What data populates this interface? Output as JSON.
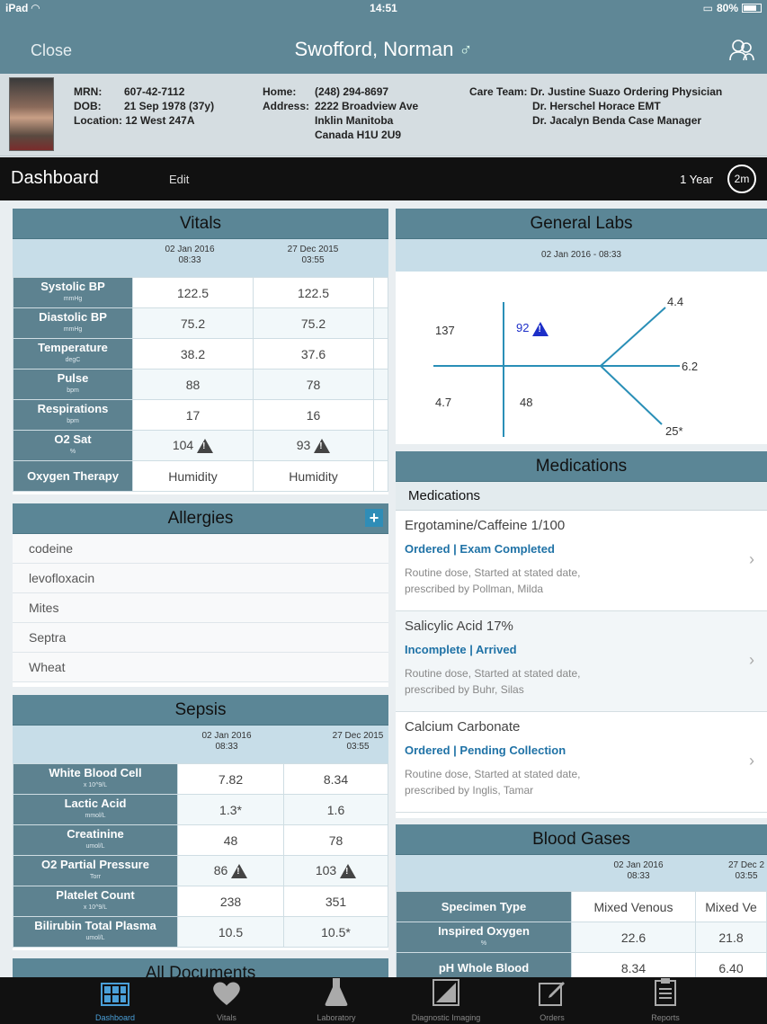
{
  "status_bar": {
    "device": "iPad",
    "time": "14:51",
    "battery": "80%"
  },
  "header": {
    "close_label": "Close",
    "patient_name": "Swofford, Norman",
    "gender_symbol": "♂"
  },
  "banner": {
    "mrn_label": "MRN:",
    "mrn": "607-42-7112",
    "dob_label": "DOB:",
    "dob": "21 Sep 1978 (37y)",
    "location": "Location: 12 West 247A",
    "home_label": "Home:",
    "home": "(248) 294-8697",
    "address_label": "Address:",
    "address1": "2222 Broadview Ave",
    "address2": "Inklin Manitoba",
    "address3": "Canada H1U 2U9",
    "care_team_label": "Care Team:",
    "care_team": [
      "Dr. Justine Suazo Ordering Physician",
      "Dr. Herschel Horace EMT",
      "Dr. Jacalyn Benda Case Manager"
    ]
  },
  "dashboard": {
    "title": "Dashboard",
    "edit": "Edit",
    "range": "1 Year",
    "refresh": "2m"
  },
  "vitals": {
    "title": "Vitals",
    "dates": [
      {
        "date": "02 Jan 2016",
        "time": "08:33"
      },
      {
        "date": "27 Dec 2015",
        "time": "03:55"
      }
    ],
    "rows": [
      {
        "label": "Systolic BP",
        "unit": "mmHg",
        "v1": "122.5",
        "v2": "122.5"
      },
      {
        "label": "Diastolic BP",
        "unit": "mmHg",
        "v1": "75.2",
        "v2": "75.2"
      },
      {
        "label": "Temperature",
        "unit": "degC",
        "v1": "38.2",
        "v2": "37.6"
      },
      {
        "label": "Pulse",
        "unit": "bpm",
        "v1": "88",
        "v2": "78"
      },
      {
        "label": "Respirations",
        "unit": "bpm",
        "v1": "17",
        "v2": "16"
      },
      {
        "label": "O2 Sat",
        "unit": "%",
        "v1": "104",
        "v2": "93"
      },
      {
        "label": "Oxygen Therapy",
        "unit": "",
        "v1": "Humidity",
        "v2": "Humidity"
      }
    ]
  },
  "allergies": {
    "title": "Allergies",
    "items": [
      "codeine",
      "levofloxacin",
      "Mites",
      "Septra",
      "Wheat"
    ]
  },
  "sepsis": {
    "title": "Sepsis",
    "dates": [
      {
        "date": "02 Jan 2016",
        "time": "08:33"
      },
      {
        "date": "27 Dec 2015",
        "time": "03:55"
      }
    ],
    "rows": [
      {
        "label": "White Blood Cell",
        "unit": "x 10^9/L",
        "v1": "7.82",
        "v2": "8.34"
      },
      {
        "label": "Lactic Acid",
        "unit": "mmol/L",
        "v1": "1.3*",
        "v2": "1.6"
      },
      {
        "label": "Creatinine",
        "unit": "umol/L",
        "v1": "48",
        "v2": "78"
      },
      {
        "label": "O2 Partial Pressure",
        "unit": "Torr",
        "v1": "86",
        "v2": "103"
      },
      {
        "label": "Platelet Count",
        "unit": "x 10^9/L",
        "v1": "238",
        "v2": "351"
      },
      {
        "label": "Bilirubin Total Plasma",
        "unit": "umol/L",
        "v1": "10.5",
        "v2": "10.5*"
      }
    ]
  },
  "documents": {
    "title": "All Documents"
  },
  "general_labs": {
    "title": "General Labs",
    "date": "02 Jan 2016 - 08:33",
    "values": {
      "na": "137",
      "cl": "92",
      "k": "4.7",
      "co2": "48",
      "top": "4.4",
      "mid": "6.2",
      "bot": "25*"
    }
  },
  "medications": {
    "title": "Medications",
    "subtitle": "Medications",
    "items": [
      {
        "name": "Ergotamine/Caffeine 1/100",
        "status": "Ordered | Exam Completed",
        "desc1": "Routine dose, Started at stated date,",
        "desc2": "prescribed by Pollman, Milda"
      },
      {
        "name": "Salicylic Acid 17%",
        "status": "Incomplete | Arrived",
        "desc1": "Routine dose, Started at stated date,",
        "desc2": "prescribed by Buhr, Silas"
      },
      {
        "name": "Calcium Carbonate",
        "status": "Ordered | Pending Collection",
        "desc1": "Routine dose, Started at stated date,",
        "desc2": "prescribed by Inglis, Tamar"
      }
    ]
  },
  "blood_gases": {
    "title": "Blood Gases",
    "dates": [
      {
        "date": "02 Jan 2016",
        "time": "08:33"
      },
      {
        "date": "27 Dec 2",
        "time": "03:55"
      }
    ],
    "rows": [
      {
        "label": "Specimen Type",
        "unit": "",
        "v1": "Mixed Venous",
        "v2": "Mixed Ve"
      },
      {
        "label": "Inspired Oxygen",
        "unit": "%",
        "v1": "22.6",
        "v2": "21.8"
      },
      {
        "label": "pH Whole Blood",
        "unit": "",
        "v1": "8.34",
        "v2": "6.40"
      }
    ]
  },
  "tabs": [
    {
      "label": "Dashboard",
      "icon": "dashboard-icon"
    },
    {
      "label": "Vitals",
      "icon": "heart-icon"
    },
    {
      "label": "Laboratory",
      "icon": "flask-icon"
    },
    {
      "label": "Diagnostic Imaging",
      "icon": "imaging-icon"
    },
    {
      "label": "Orders",
      "icon": "orders-icon"
    },
    {
      "label": "Reports",
      "icon": "clipboard-icon"
    }
  ]
}
